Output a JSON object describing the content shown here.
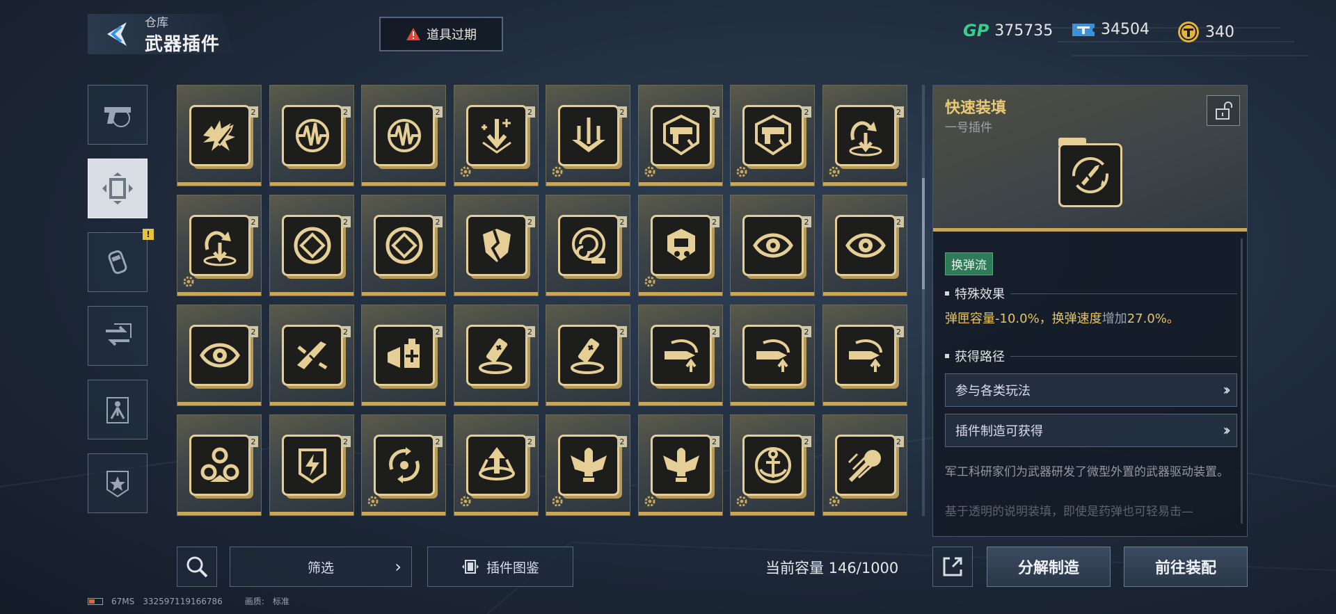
{
  "header": {
    "category": "仓库",
    "title": "武器插件",
    "expire_alert": "道具过期"
  },
  "currencies": [
    {
      "name": "gp-currency",
      "label": "GP",
      "value": "375735",
      "color": "#34d18b"
    },
    {
      "name": "ticket-currency",
      "value": "34504",
      "color": "#3d8fd6"
    },
    {
      "name": "coin-currency",
      "value": "340",
      "color": "#e2b43a"
    }
  ],
  "categories": [
    {
      "name": "pistol",
      "icon": "pistol-icon",
      "active": false
    },
    {
      "name": "plugin",
      "icon": "plugin-chip-icon",
      "active": true
    },
    {
      "name": "grenade",
      "icon": "grenade-icon",
      "active": false,
      "badge": "!"
    },
    {
      "name": "transfer",
      "icon": "transfer-icon",
      "active": false
    },
    {
      "name": "character",
      "icon": "character-icon",
      "active": false
    },
    {
      "name": "favorite",
      "icon": "star-badge-icon",
      "active": false
    }
  ],
  "items": [
    {
      "icon": "explosive-bullet-icon",
      "level": "2",
      "gear": false
    },
    {
      "icon": "pulse-wave-icon",
      "level": "2",
      "gear": false
    },
    {
      "icon": "pulse-wave-icon",
      "level": "2",
      "gear": false
    },
    {
      "icon": "arrow-down-plus-icon",
      "level": "2",
      "gear": true
    },
    {
      "icon": "triple-arrow-down-icon",
      "level": "2",
      "gear": true
    },
    {
      "icon": "shield-gun-icon",
      "level": "2",
      "gear": true
    },
    {
      "icon": "shield-gun-icon",
      "level": "2",
      "gear": true
    },
    {
      "icon": "reload-down-icon",
      "level": "2",
      "gear": true
    },
    {
      "icon": "reload-down-icon",
      "level": "2",
      "gear": true
    },
    {
      "icon": "target-ring-icon",
      "level": "2",
      "gear": false
    },
    {
      "icon": "target-ring-icon",
      "level": "2",
      "gear": false
    },
    {
      "icon": "broken-shield-icon",
      "level": "2",
      "gear": false
    },
    {
      "icon": "vortex-ammo-icon",
      "level": "2",
      "gear": false
    },
    {
      "icon": "armored-unit-icon",
      "level": "2",
      "gear": true
    },
    {
      "icon": "eye-sensor-icon",
      "level": "2",
      "gear": false
    },
    {
      "icon": "eye-sensor-icon",
      "level": "2",
      "gear": false
    },
    {
      "icon": "eye-sensor-icon",
      "level": "2",
      "gear": false
    },
    {
      "icon": "shattered-blade-icon",
      "level": "2",
      "gear": false
    },
    {
      "icon": "medkit-shield-icon",
      "level": "2",
      "gear": false
    },
    {
      "icon": "medic-vial-icon",
      "level": "2",
      "gear": false
    },
    {
      "icon": "medic-vial-icon",
      "level": "2",
      "gear": false
    },
    {
      "icon": "bullet-upgrade-icon",
      "level": "2",
      "gear": false
    },
    {
      "icon": "bullet-upgrade-icon",
      "level": "2",
      "gear": false
    },
    {
      "icon": "bullet-upgrade-icon",
      "level": "2",
      "gear": false
    },
    {
      "icon": "triple-node-icon",
      "level": "2",
      "gear": false
    },
    {
      "icon": "battery-shield-icon",
      "level": "2",
      "gear": false
    },
    {
      "icon": "recycle-target-icon",
      "level": "2",
      "gear": true
    },
    {
      "icon": "spin-arrow-icon",
      "level": "2",
      "gear": true
    },
    {
      "icon": "winged-bullet-icon",
      "level": "2",
      "gear": true
    },
    {
      "icon": "winged-bullet-icon",
      "level": "2",
      "gear": true
    },
    {
      "icon": "anchor-icon",
      "level": "2",
      "gear": true
    },
    {
      "icon": "meteor-icon",
      "level": "2",
      "gear": true
    }
  ],
  "detail": {
    "name": "快速装填",
    "slot": "一号插件",
    "icon": "fast-reload-icon",
    "tag": "换弹流",
    "effect_title": "特殊效果",
    "effect_part1": "弹匣容量-10.0%，换弹速度",
    "effect_increase": "增加",
    "effect_part2": "27.0%。",
    "route_title": "获得路径",
    "routes": [
      "参与各类玩法",
      "插件制造可获得"
    ],
    "description": "军工科研家们为武器研发了微型外置的武器驱动装置。",
    "description_more": "基于透明的说明装填，即使是药弹也可轻易击—"
  },
  "bottom": {
    "filter_label": "筛选",
    "codex_label": "插件图鉴",
    "capacity_label": "当前容量 146/1000",
    "dismantle_label": "分解制造",
    "equip_label": "前往装配"
  },
  "status": {
    "ping": "67MS",
    "uid": "332597119166786",
    "quality_label": "画质:",
    "quality_value": "标准"
  },
  "colors": {
    "gold": "#c9a75a",
    "gold_text": "#e9c872",
    "tag_green": "#2f7a57",
    "warning_red": "#e0443a"
  }
}
